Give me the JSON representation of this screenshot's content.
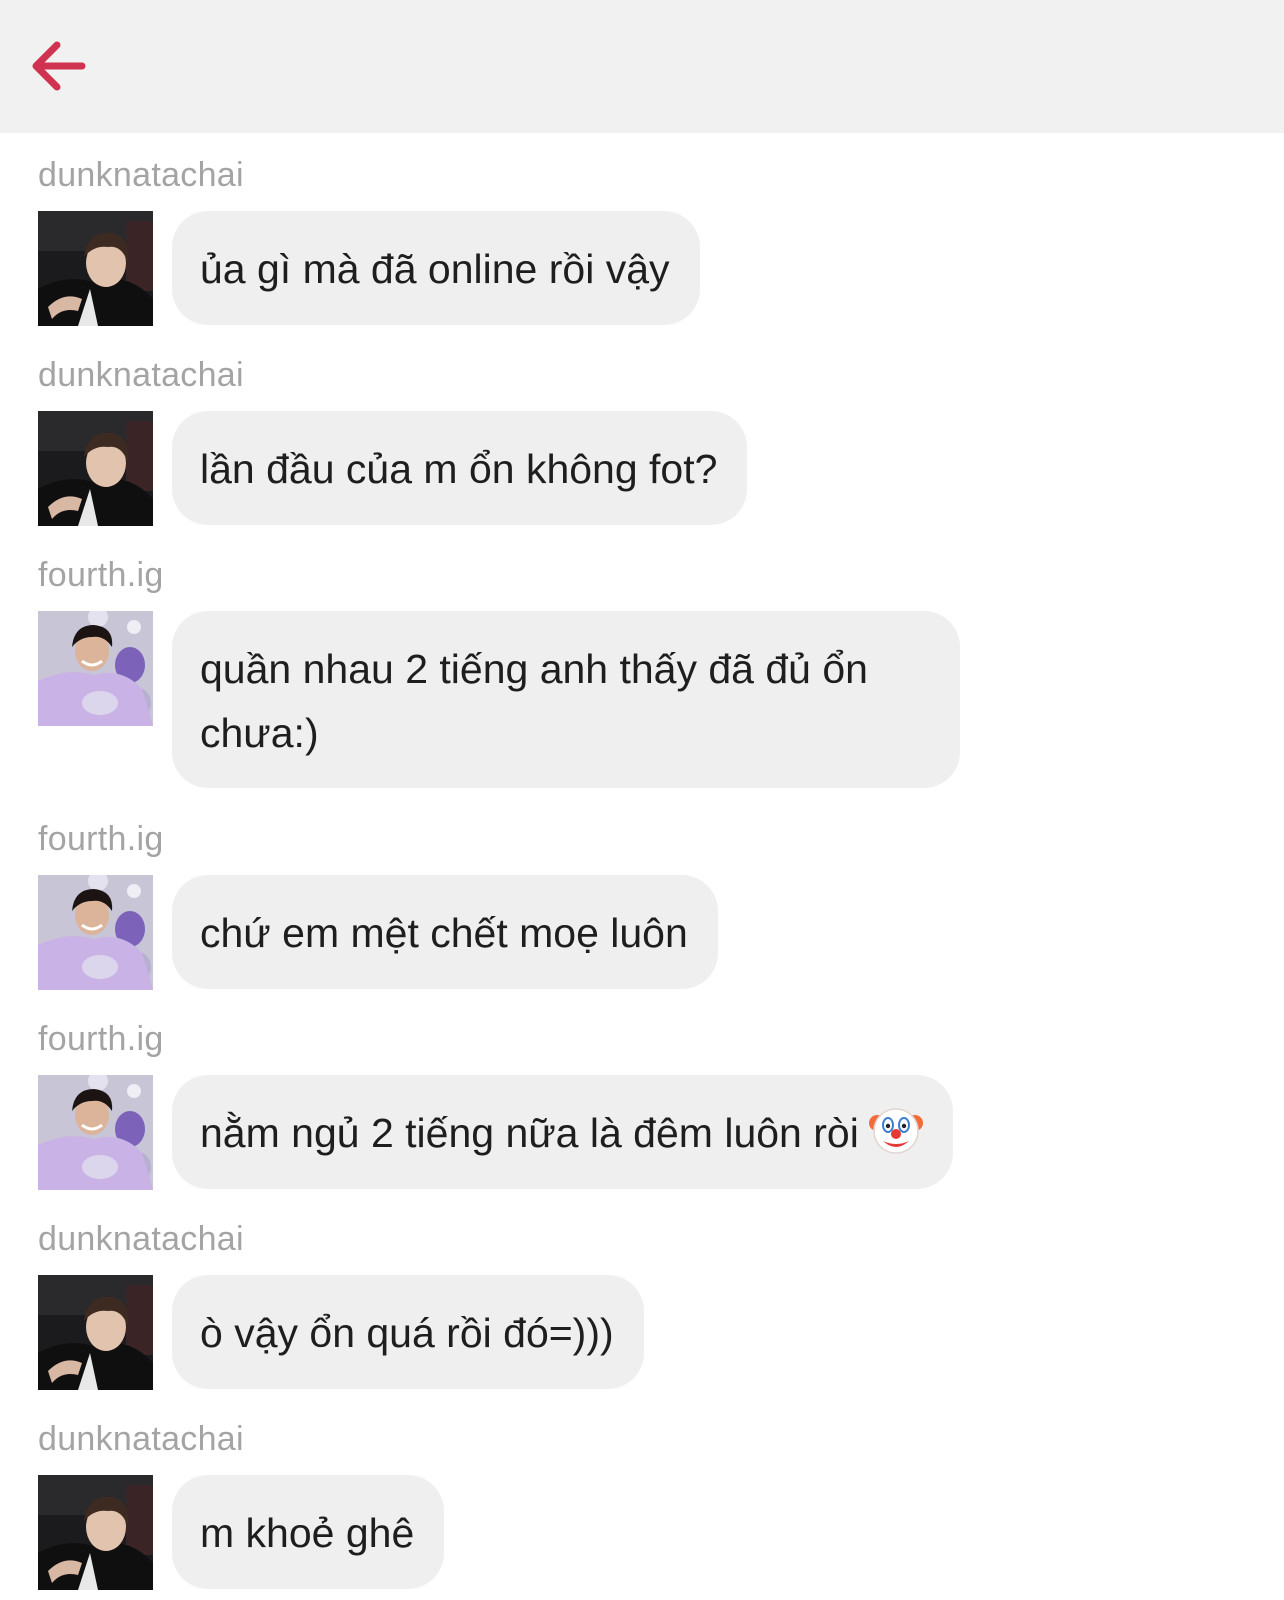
{
  "header": {
    "back_icon": "arrow-left-icon",
    "accent_color": "#d0334f"
  },
  "messages": [
    {
      "username": "dunknatachai",
      "avatar": "dunk-avatar",
      "text": "ủa gì mà đã online rồi vậy"
    },
    {
      "username": "dunknatachai",
      "avatar": "dunk-avatar",
      "text": "lần đầu của m ổn không fot?"
    },
    {
      "username": "fourth.ig",
      "avatar": "fourth-avatar",
      "text": "quần nhau 2 tiếng anh thấy đã đủ ổn chưa:)"
    },
    {
      "username": "fourth.ig",
      "avatar": "fourth-avatar",
      "text": "chứ em mệt chết moẹ luôn"
    },
    {
      "username": "fourth.ig",
      "avatar": "fourth-avatar",
      "text": "nằm ngủ 2 tiếng nữa là đêm luôn ròi",
      "emoji": "clown-face-icon"
    },
    {
      "username": "dunknatachai",
      "avatar": "dunk-avatar",
      "text": "ò vậy ổn quá rồi đó=)))"
    },
    {
      "username": "dunknatachai",
      "avatar": "dunk-avatar",
      "text": "m khoẻ ghê"
    }
  ]
}
